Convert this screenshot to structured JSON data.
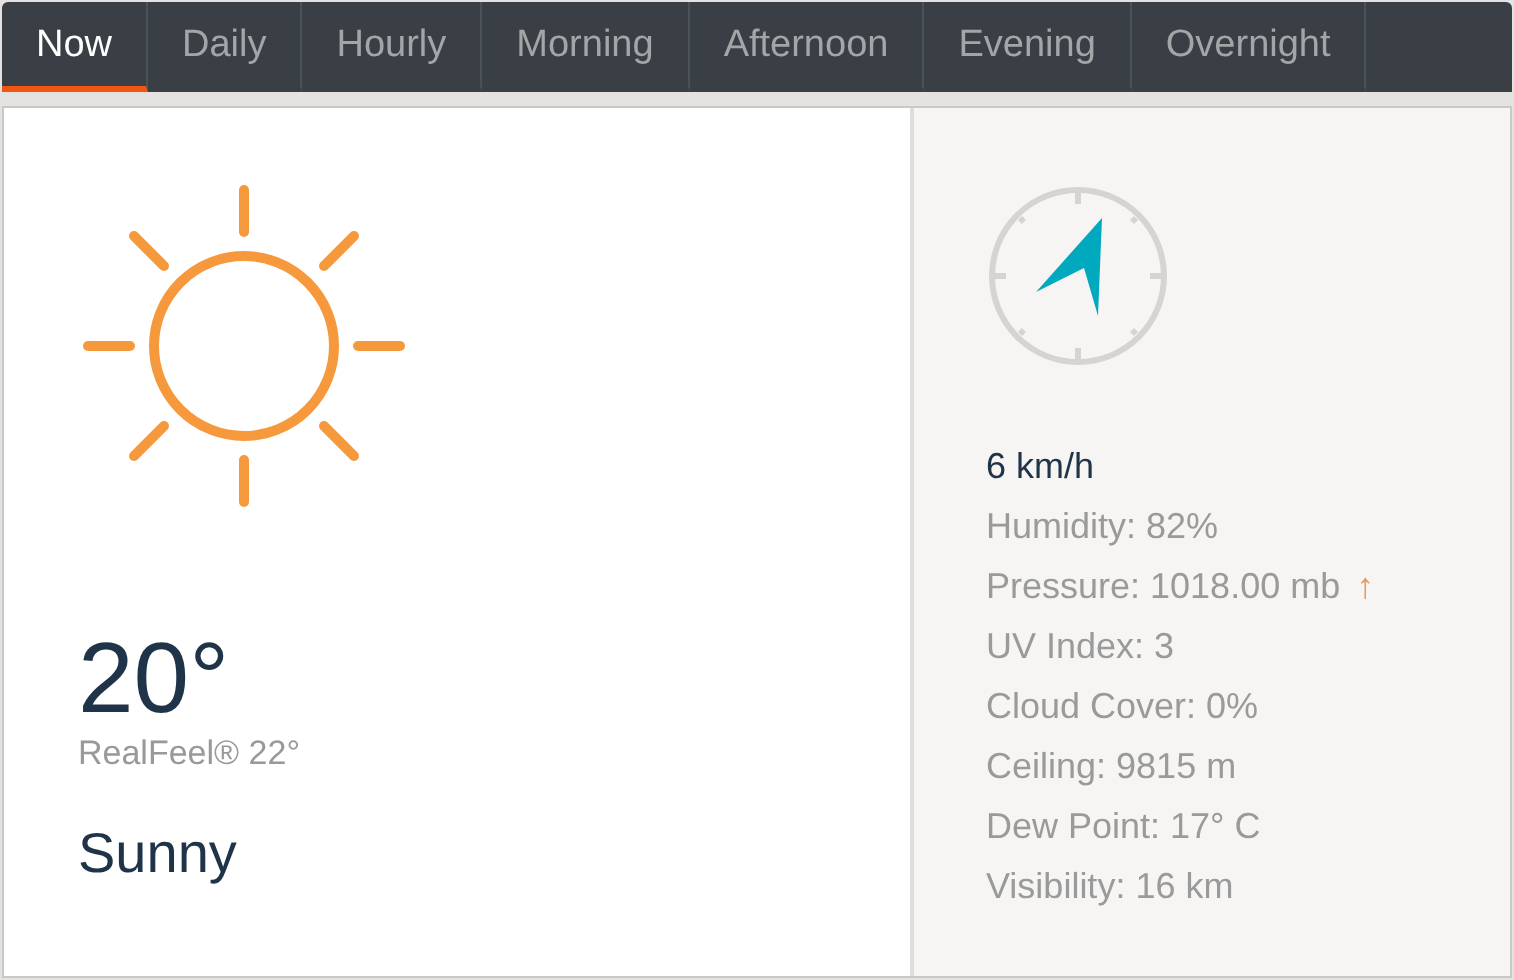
{
  "tabs": [
    {
      "label": "Now",
      "selected": true
    },
    {
      "label": "Daily",
      "selected": false
    },
    {
      "label": "Hourly",
      "selected": false
    },
    {
      "label": "Morning",
      "selected": false
    },
    {
      "label": "Afternoon",
      "selected": false
    },
    {
      "label": "Evening",
      "selected": false
    },
    {
      "label": "Overnight",
      "selected": false
    }
  ],
  "current": {
    "temperature": "20°",
    "realfeel": "RealFeel® 22°",
    "condition": "Sunny"
  },
  "details": {
    "wind_speed": "6 km/h",
    "rows": [
      {
        "text": "Humidity: 82%"
      },
      {
        "text": "Pressure: 1018.00 mb",
        "trend": "↑"
      },
      {
        "text": "UV Index: 3"
      },
      {
        "text": "Cloud Cover: 0%"
      },
      {
        "text": "Ceiling: 9815 m"
      },
      {
        "text": "Dew Point: 17° C"
      },
      {
        "text": "Visibility: 16 km"
      }
    ]
  }
}
